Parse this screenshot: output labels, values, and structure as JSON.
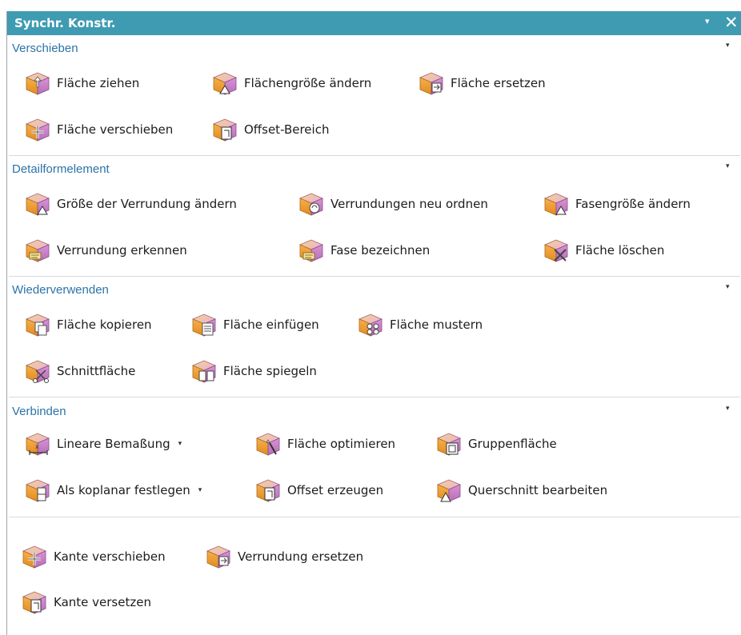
{
  "panel": {
    "title": "Synchr. Konstr.",
    "pin_glyph": "▾",
    "close_glyph": "✕"
  },
  "sections": [
    {
      "title": "Verschieben",
      "items": [
        {
          "label": "Fläche ziehen",
          "icon": "pull-face-icon"
        },
        {
          "label": "Flächengröße ändern",
          "icon": "resize-face-icon"
        },
        {
          "label": "Fläche ersetzen",
          "icon": "replace-face-icon"
        },
        {
          "label": "Fläche verschieben",
          "icon": "move-face-icon"
        },
        {
          "label": "Offset-Bereich",
          "icon": "offset-region-icon"
        }
      ]
    },
    {
      "title": "Detailformelement",
      "items": [
        {
          "label": "Größe der Verrundung ändern",
          "icon": "resize-blend-icon"
        },
        {
          "label": "Verrundungen neu ordnen",
          "icon": "reorder-blend-icon"
        },
        {
          "label": "Fasengröße ändern",
          "icon": "resize-chamfer-icon"
        },
        {
          "label": "Verrundung erkennen",
          "icon": "label-blend-icon"
        },
        {
          "label": "Fase bezeichnen",
          "icon": "label-chamfer-icon"
        },
        {
          "label": "Fläche löschen",
          "icon": "delete-face-icon"
        }
      ]
    },
    {
      "title": "Wiederverwenden",
      "items": [
        {
          "label": "Fläche kopieren",
          "icon": "copy-face-icon"
        },
        {
          "label": "Fläche einfügen",
          "icon": "paste-face-icon"
        },
        {
          "label": "Fläche mustern",
          "icon": "pattern-face-icon"
        },
        {
          "label": "Schnittfläche",
          "icon": "cut-face-icon"
        },
        {
          "label": "Fläche spiegeln",
          "icon": "mirror-face-icon"
        }
      ]
    },
    {
      "title": "Verbinden",
      "items": [
        {
          "label": "Lineare Bemaßung",
          "icon": "linear-dimension-icon",
          "dropdown": "▾"
        },
        {
          "label": "Fläche optimieren",
          "icon": "optimize-face-icon"
        },
        {
          "label": "Gruppenfläche",
          "icon": "group-face-icon"
        },
        {
          "label": "Als koplanar festlegen",
          "icon": "make-coplanar-icon",
          "dropdown": "▾"
        },
        {
          "label": "Offset erzeugen",
          "icon": "make-offset-icon"
        },
        {
          "label": "Querschnitt bearbeiten",
          "icon": "cross-section-icon"
        }
      ]
    },
    {
      "title": "",
      "items": [
        {
          "label": "Kante verschieben",
          "icon": "move-edge-icon"
        },
        {
          "label": "Verrundung ersetzen",
          "icon": "replace-blend-icon"
        },
        {
          "label": "Kante versetzen",
          "icon": "offset-edge-icon"
        }
      ]
    }
  ],
  "section_menu_glyph": "▾",
  "colors": {
    "titlebar": "#3f9bb2",
    "section_title": "#2b74a8",
    "cube_orange": "#f2a53a",
    "cube_magenta": "#c77cc4"
  }
}
